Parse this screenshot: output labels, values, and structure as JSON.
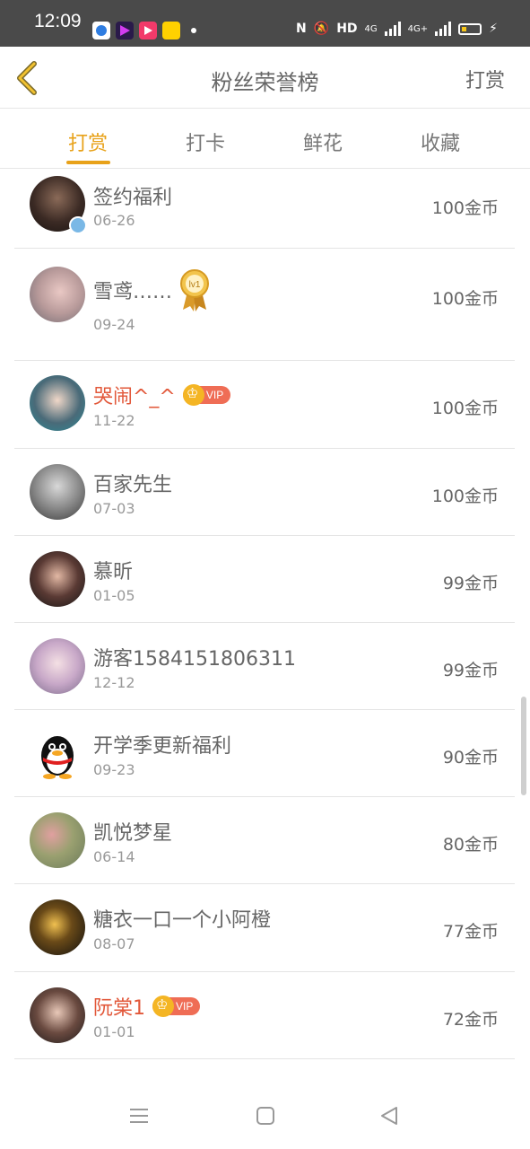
{
  "status_bar": {
    "time": "12:09",
    "network": "HD",
    "signal_labels": [
      "4G",
      "4G+"
    ],
    "icons": [
      "nfc-icon",
      "mute-icon",
      "battery-icon",
      "charging-icon"
    ]
  },
  "header": {
    "title": "粉丝荣誉榜",
    "action": "打赏"
  },
  "tabs": [
    {
      "label": "打赏",
      "active": true
    },
    {
      "label": "打卡",
      "active": false
    },
    {
      "label": "鲜花",
      "active": false
    },
    {
      "label": "收藏",
      "active": false
    }
  ],
  "colors": {
    "accent": "#e8a21a",
    "vip_name": "#e2583a",
    "vip_badge": "#ef6d55"
  },
  "rows": [
    {
      "name": "签约福利",
      "date": "06-26",
      "amount": "100金币",
      "vip": false
    },
    {
      "name": "雪鸢……",
      "date": "09-24",
      "amount": "100金币",
      "vip": false,
      "medal": "lv1"
    },
    {
      "name": "哭闹^_^",
      "date": "11-22",
      "amount": "100金币",
      "vip": true,
      "vip_label": "VIP"
    },
    {
      "name": "百家先生",
      "date": "07-03",
      "amount": "100金币",
      "vip": false
    },
    {
      "name": "慕昕",
      "date": "01-05",
      "amount": "99金币",
      "vip": false
    },
    {
      "name": "游客1584151806311",
      "date": "12-12",
      "amount": "99金币",
      "vip": false
    },
    {
      "name": "开学季更新福利",
      "date": "09-23",
      "amount": "90金币",
      "vip": false
    },
    {
      "name": "凯悦梦星",
      "date": "06-14",
      "amount": "80金币",
      "vip": false
    },
    {
      "name": "糖衣一口一个小阿橙",
      "date": "08-07",
      "amount": "77金币",
      "vip": false
    },
    {
      "name": "阮棠1",
      "date": "01-01",
      "amount": "72金币",
      "vip": true,
      "vip_label": "VIP"
    }
  ],
  "nav": [
    "menu-icon",
    "home-icon",
    "back-icon"
  ]
}
